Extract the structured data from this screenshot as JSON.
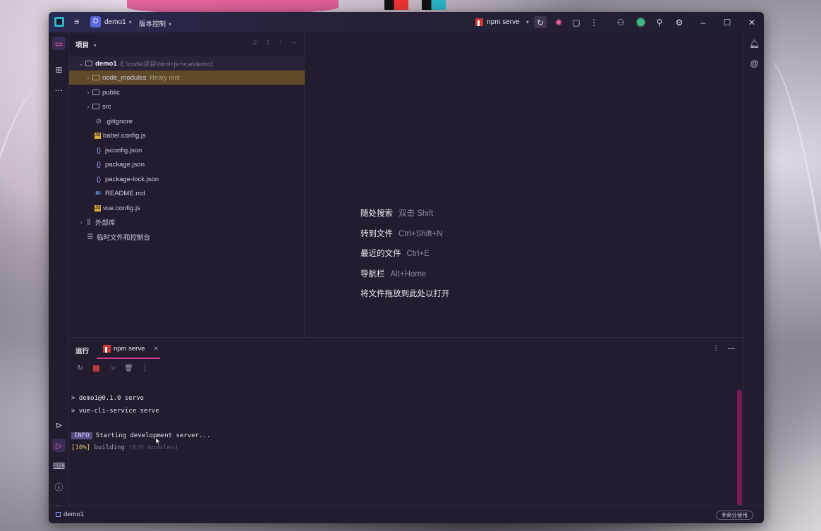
{
  "titlebar": {
    "project_badge": "D",
    "project_name": "demo1",
    "vcs_label": "版本控制",
    "run_config": "npm serve"
  },
  "project_panel": {
    "header": "项目",
    "tree": [
      {
        "name": "demo1",
        "extra": "E:\\code\\项目\\html+js+vue\\demo1",
        "icon": "folder-icon",
        "level": 0,
        "expanded": true
      },
      {
        "name": "node_modules",
        "extra": "library root",
        "icon": "folder-icon",
        "level": 1,
        "expanded": false,
        "highlighted": true
      },
      {
        "name": "public",
        "extra": "",
        "icon": "folder-icon",
        "level": 1,
        "expanded": false
      },
      {
        "name": "src",
        "extra": "",
        "icon": "folder-icon",
        "level": 1,
        "expanded": false
      },
      {
        "name": ".gitignore",
        "extra": "",
        "icon": "ignore-file-icon",
        "level": 1
      },
      {
        "name": "babel.config.js",
        "extra": "",
        "icon": "js-file-icon",
        "level": 1
      },
      {
        "name": "jsconfig.json",
        "extra": "",
        "icon": "json-file-icon",
        "level": 1
      },
      {
        "name": "package.json",
        "extra": "",
        "icon": "json-file-icon",
        "level": 1
      },
      {
        "name": "package-lock.json",
        "extra": "",
        "icon": "json-file-icon",
        "level": 1
      },
      {
        "name": "README.md",
        "extra": "",
        "icon": "markdown-file-icon",
        "level": 1
      },
      {
        "name": "vue.config.js",
        "extra": "",
        "icon": "js-file-icon",
        "level": 1
      },
      {
        "name": "外部库",
        "extra": "",
        "icon": "library-icon",
        "level": 0,
        "expanded": false
      },
      {
        "name": "临时文件和控制台",
        "extra": "",
        "icon": "scratch-icon",
        "level": 0
      }
    ]
  },
  "editor_hints": [
    {
      "label": "随处搜索",
      "keys": "双击 Shift"
    },
    {
      "label": "转到文件",
      "keys": "Ctrl+Shift+N"
    },
    {
      "label": "最近的文件",
      "keys": "Ctrl+E"
    },
    {
      "label": "导航栏",
      "keys": "Alt+Home"
    },
    {
      "label": "将文件拖放到此处以打开",
      "keys": ""
    }
  ],
  "run_panel": {
    "title": "运行",
    "tab_label": "npm serve",
    "console": {
      "line1": "> demo1@0.1.0 serve",
      "line2": "> vue-cli-service serve",
      "info_badge": "INFO",
      "info_text": "Starting development server...",
      "progress_pct": "[10%]",
      "progress_text": "building",
      "progress_dim": "(0/0 modules)"
    }
  },
  "statusbar": {
    "project": "demo1",
    "license_badge": "非商业使用"
  },
  "colors": {
    "window_bg": "#221c2e",
    "accent_pink": "#d13a8a",
    "highlight_row": "#5f4b2a",
    "scrollbar": "#7a1b5c"
  }
}
